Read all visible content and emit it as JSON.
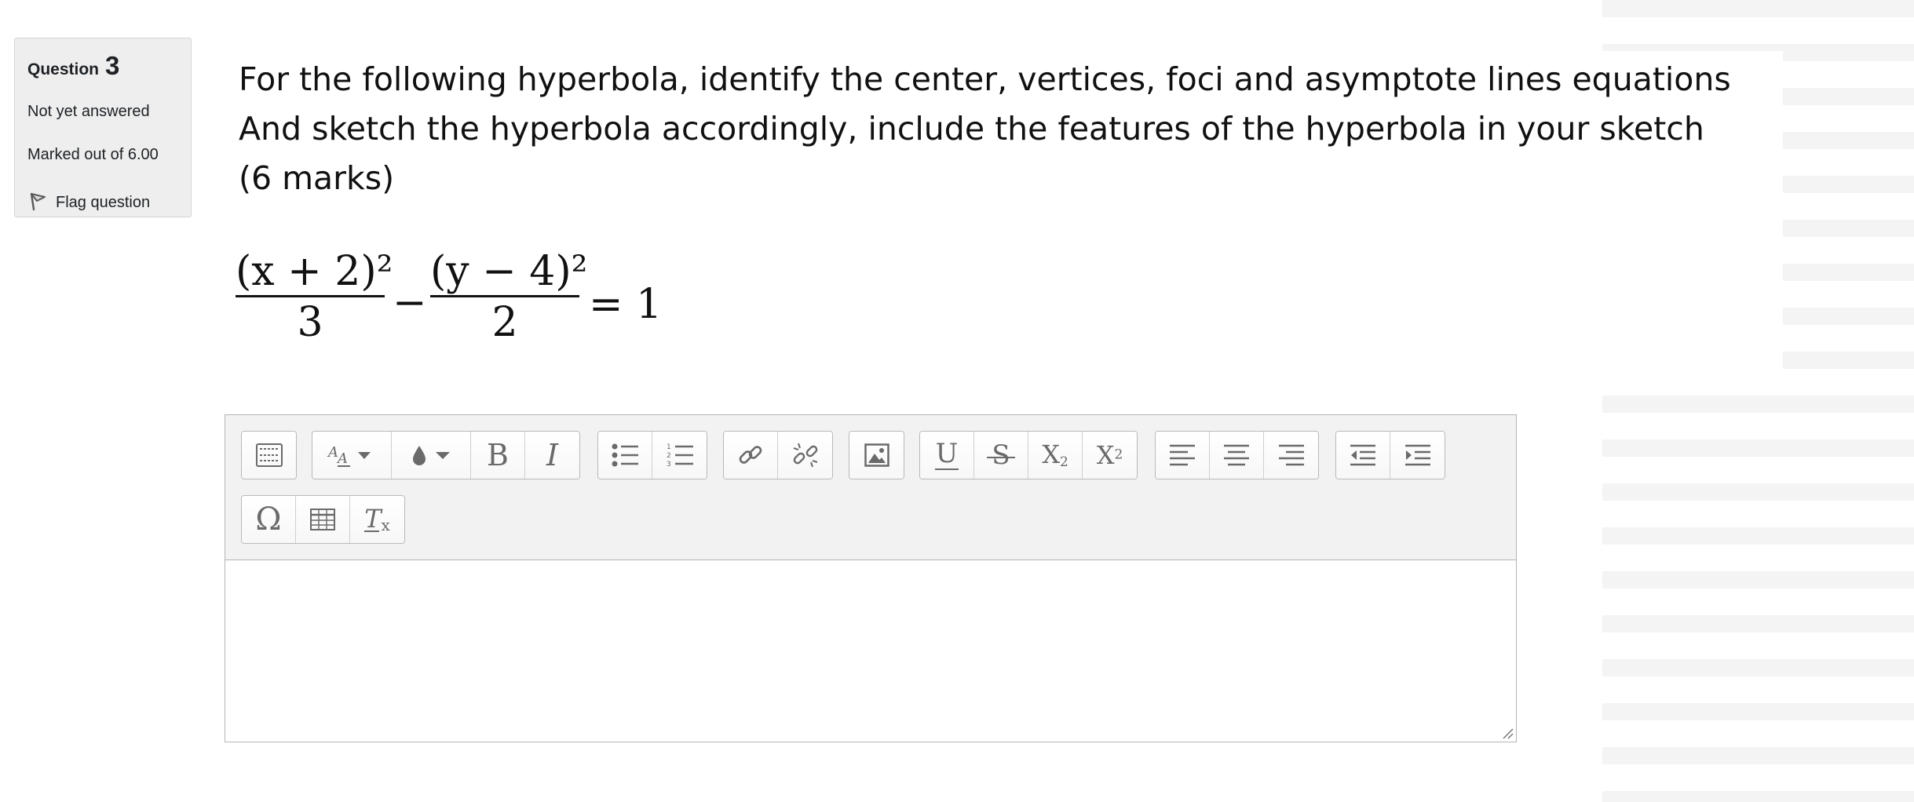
{
  "info": {
    "question_label": "Question",
    "question_number": "3",
    "state": "Not yet answered",
    "grade": "Marked out of 6.00",
    "flag_label": "Flag question",
    "flag_icon": "flag-icon"
  },
  "question": {
    "line1": "For the following hyperbola, identify the center, vertices, foci and asymptote lines equations",
    "line2": "And sketch the hyperbola accordingly, include the features of the hyperbola in your sketch",
    "line3": "(6 marks)"
  },
  "formula": {
    "numerator1": "(x + 2)²",
    "denominator1": "3",
    "minus": "−",
    "numerator2": "(y − 4)²",
    "denominator2": "2",
    "equals": "= 1"
  },
  "toolbar": {
    "row1": [
      [
        "toolbar-toggle-icon"
      ],
      [
        "font-size-icon",
        "font-color-icon",
        "bold-icon",
        "italic-icon"
      ],
      [
        "unordered-list-icon",
        "ordered-list-icon"
      ],
      [
        "link-icon",
        "unlink-icon"
      ],
      [
        "image-icon"
      ],
      [
        "underline-icon",
        "strikethrough-icon",
        "subscript-icon",
        "superscript-icon"
      ],
      [
        "align-left-icon",
        "align-center-icon",
        "align-right-icon"
      ],
      [
        "outdent-icon",
        "indent-icon"
      ]
    ],
    "row2": [
      [
        "special-character-icon",
        "table-icon",
        "clear-formatting-icon"
      ]
    ],
    "labels": {
      "bold": "B",
      "italic": "I",
      "underline": "U",
      "strike": "S",
      "sub_base": "X",
      "sub_script": "2",
      "sup_base": "X",
      "sup_script": "2",
      "omega": "Ω",
      "clear_base": "T",
      "clear_sub": "x"
    }
  },
  "editor": {
    "content": ""
  }
}
